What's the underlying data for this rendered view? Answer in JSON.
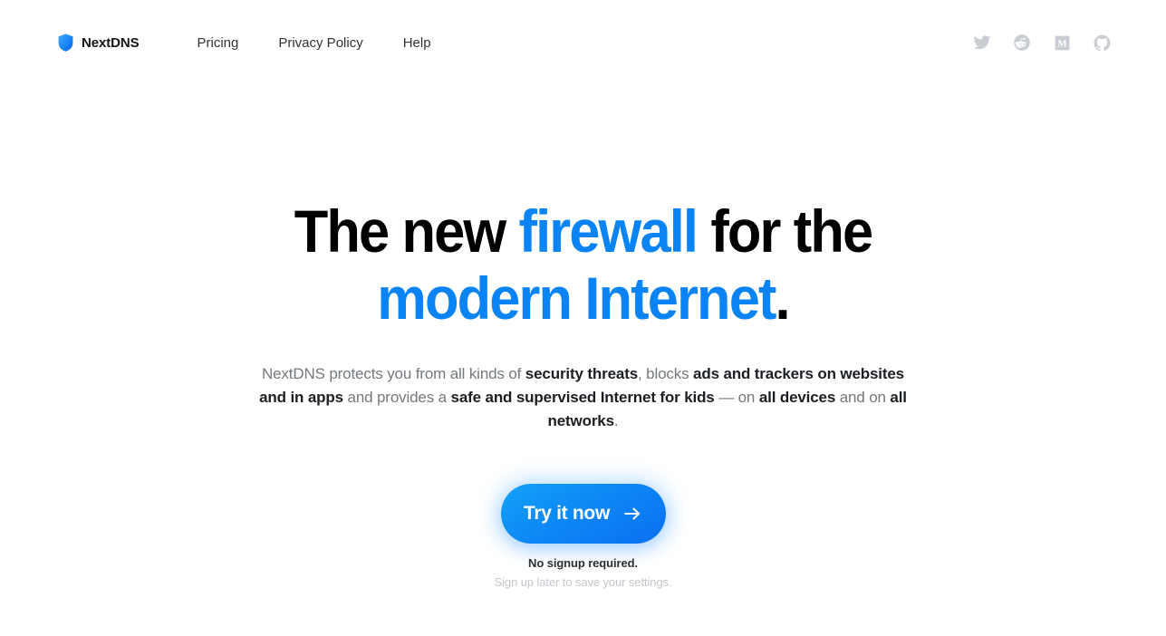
{
  "brand": {
    "name": "NextDNS",
    "logo_icon": "shield-icon",
    "logo_color_light": "#3aa0ff",
    "logo_color_dark": "#0a63e8"
  },
  "nav": {
    "links": [
      {
        "label": "Pricing"
      },
      {
        "label": "Privacy Policy"
      },
      {
        "label": "Help"
      }
    ]
  },
  "socials": [
    {
      "icon": "twitter-icon",
      "label": "Twitter"
    },
    {
      "icon": "reddit-icon",
      "label": "Reddit"
    },
    {
      "icon": "medium-icon",
      "label": "Medium"
    },
    {
      "icon": "github-icon",
      "label": "GitHub"
    }
  ],
  "hero": {
    "headline_line1_part1": "The new ",
    "headline_line1_accent": "firewall",
    "headline_line1_part2": " for the",
    "headline_line2_accent": "modern Internet",
    "headline_line2_dot": ".",
    "accent_color": "#0a84f5",
    "subtitle": {
      "s1": "NextDNS protects you from all kinds of ",
      "b1": "security threats",
      "s2": ", blocks ",
      "b2": "ads and trackers on websites and in apps",
      "s3": " and provides a ",
      "b3": "safe and supervised Internet for kids",
      "s4": " — on ",
      "b4": "all devices",
      "s5": " and on ",
      "b5": "all networks",
      "s6": "."
    }
  },
  "cta": {
    "button_label": "Try it now",
    "button_icon": "arrow-right-icon",
    "note": "No signup required.",
    "subnote": "Sign up later to save your settings.",
    "gradient_from": "#13a2f8",
    "gradient_to": "#0a6ff0"
  }
}
